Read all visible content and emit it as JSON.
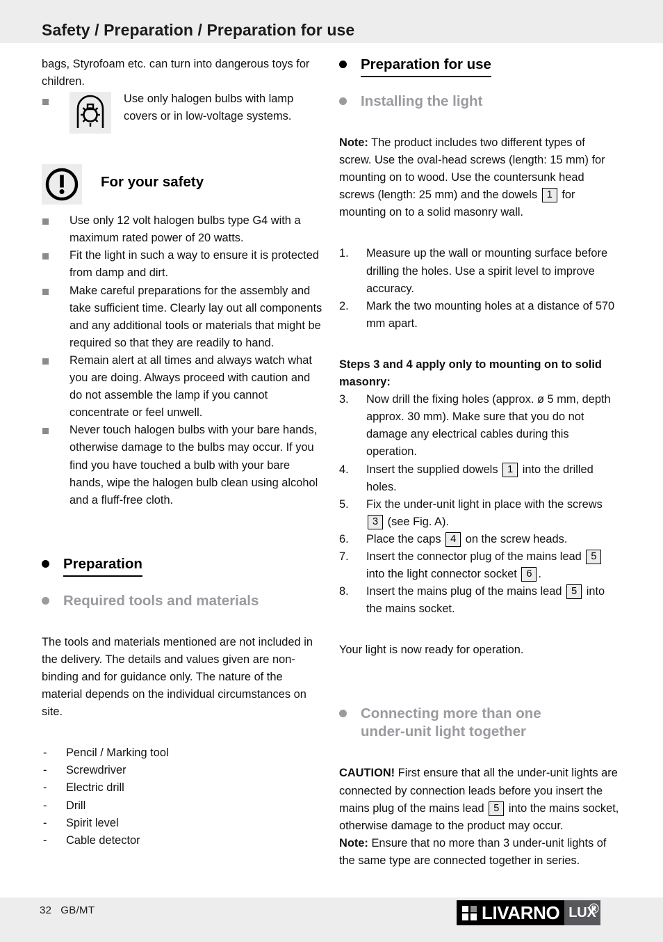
{
  "header": {
    "title": "Safety / Preparation / Preparation for use"
  },
  "left_column": {
    "intro_continued": "bags, Styrofoam etc. can turn into dangerous toys for children.",
    "bulb_notice": {
      "icon": "halogen-bulb-lamp-cover-icon",
      "text": "Use only halogen bulbs with lamp covers or in low-voltage systems."
    },
    "safety": {
      "icon": "exclamation-warning-icon",
      "title": "For your safety",
      "items": [
        "Use only 12 volt halogen bulbs type G4 with a maximum rated  power of 20 watts.",
        "Fit the light in such a way to ensure it is protected from damp and dirt.",
        "Make careful preparations for the assembly and take sufficient time. Clearly lay out all components and any additional tools or materials that might be required so that they are readily to hand.",
        "Remain alert at all times and always watch what you are doing. Always proceed with caution and do not assemble the lamp if you cannot concentrate or feel unwell.",
        "Never touch halogen bulbs with your bare hands, otherwise damage to the bulbs may occur. If you find you have touched a bulb with your bare hands, wipe the halogen bulb clean using alcohol and a fluff-free cloth."
      ]
    },
    "preparation": {
      "heading": "Preparation",
      "subheading": "Required tools and materials",
      "paragraph": "The tools and materials mentioned are not included in the delivery. The details and values given are non-binding and for guidance only. The nature of the material depends on the individual circumstances on site.",
      "tools": [
        "Pencil / Marking tool",
        "Screwdriver",
        "Electric drill",
        "Drill",
        "Spirit level",
        "Cable detector"
      ],
      "dash": "-"
    }
  },
  "right_column": {
    "preparation_for_use": {
      "heading": "Preparation for use",
      "subheading": "Installing the light",
      "note_label": "Note:",
      "note_part1": " The product includes two different types of screw. Use the oval-head screws (length: 15 mm) for mounting on to wood. Use the countersunk head screws (length: 25 mm) and the dowels ",
      "note_ref1": "1",
      "note_part2": " for mounting on to a solid masonry wall."
    },
    "steps_first": [
      {
        "num": "1.",
        "text": "Measure up the wall or mounting surface before drilling the holes. Use a spirit level to improve accuracy."
      },
      {
        "num": "2.",
        "text": "Mark the two mounting holes at a distance of 570 mm apart."
      }
    ],
    "masonry_heading": "Steps 3 and 4 apply only to mounting on to solid masonry:",
    "steps_second": [
      {
        "num": "3.",
        "parts": [
          {
            "t": "Now drill the fixing holes (approx. ø 5 mm, depth approx. 30 mm). Make sure that you do not damage any electrical cables during this operation."
          }
        ]
      },
      {
        "num": "4.",
        "parts": [
          {
            "t": "Insert the supplied dowels "
          },
          {
            "ref": "1"
          },
          {
            "t": " into the drilled holes."
          }
        ]
      },
      {
        "num": "5.",
        "parts": [
          {
            "t": "Fix the under-unit light in place with the screws "
          },
          {
            "ref": "3"
          },
          {
            "t": " (see Fig. A)."
          }
        ]
      },
      {
        "num": "6.",
        "parts": [
          {
            "t": "Place the caps "
          },
          {
            "ref": "4"
          },
          {
            "t": " on the screw heads."
          }
        ]
      },
      {
        "num": "7.",
        "parts": [
          {
            "t": "Insert the connector plug of the mains lead "
          },
          {
            "ref": "5"
          },
          {
            "t": " into the light connector socket "
          },
          {
            "ref": "6"
          },
          {
            "t": "."
          }
        ]
      },
      {
        "num": "8.",
        "parts": [
          {
            "t": "Insert the mains plug of the mains lead "
          },
          {
            "ref": "5"
          },
          {
            "t": " into the mains socket."
          }
        ]
      }
    ],
    "ready_text": "Your light is now ready for operation.",
    "connecting": {
      "subheading_line1": "Connecting more than one",
      "subheading_line2": "under-unit light together",
      "caution_label": "CAUTION!",
      "caution_part1": " First ensure that all the under-unit lights are connected by connection leads before you insert the mains plug of the mains lead ",
      "caution_ref": "5",
      "caution_part2": " into the mains socket, otherwise damage to the product may occur.",
      "note_label": "Note:",
      "note_text": " Ensure that no more than 3 under-unit lights of the same type are connected together in series."
    }
  },
  "footer": {
    "page_number": "32",
    "locale": "GB/MT",
    "logo_word": "LIVARNO",
    "logo_sub": "LUX",
    "logo_reg": "®"
  },
  "colors": {
    "band_gray": "#ededed",
    "heading_gray": "#9a9a9f",
    "bullet_gray": "#8a8a90",
    "icon_bg": "#ececec",
    "logo_gray": "#58585c"
  }
}
